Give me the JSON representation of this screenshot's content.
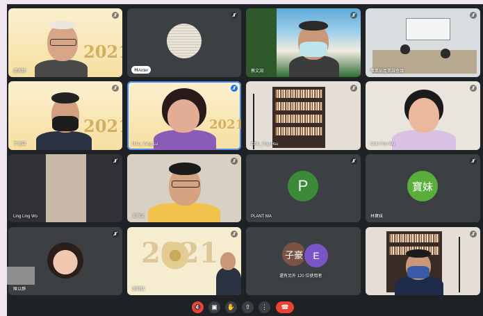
{
  "participants": [
    {
      "name": "盧源鎮"
    },
    {
      "name": "林Anter"
    },
    {
      "name": "蔡文淵"
    },
    {
      "name": "農業局產業課會議"
    },
    {
      "name": "丁俊霖"
    },
    {
      "name": "Hsiu_Yang Lu"
    },
    {
      "name": "Chih_Ting Hsu"
    },
    {
      "name": "Chih-Yun Wu"
    },
    {
      "name": "Ling Ling Wo"
    },
    {
      "name": "王修文"
    },
    {
      "name": "PLANT MA",
      "initial": "P",
      "color": "#3a8a3a"
    },
    {
      "name": "林寶妹",
      "initial": "寶妹",
      "color": "#5aae3a"
    },
    {
      "name": "陳以靜"
    },
    {
      "name": "謝育銘"
    },
    {
      "name": "還有另外 120 位使用者",
      "initials": [
        "子豪",
        "E"
      ],
      "colors": [
        "#7a5344",
        "#7a55c8"
      ]
    },
    {
      "name": ""
    }
  ],
  "posters": {
    "year_top": "2021",
    "year_mid": "2021",
    "year_bottom": "2021"
  },
  "controls": {
    "mic": "mic-off-icon",
    "camera": "camera-icon",
    "hand": "raise-hand-icon",
    "present": "present-screen-icon",
    "more": "more-options-icon",
    "hangup": "hang-up-icon"
  },
  "colors": {
    "accent": "#1a73e8",
    "hangup": "#ea4335",
    "tile": "#3c4043"
  }
}
